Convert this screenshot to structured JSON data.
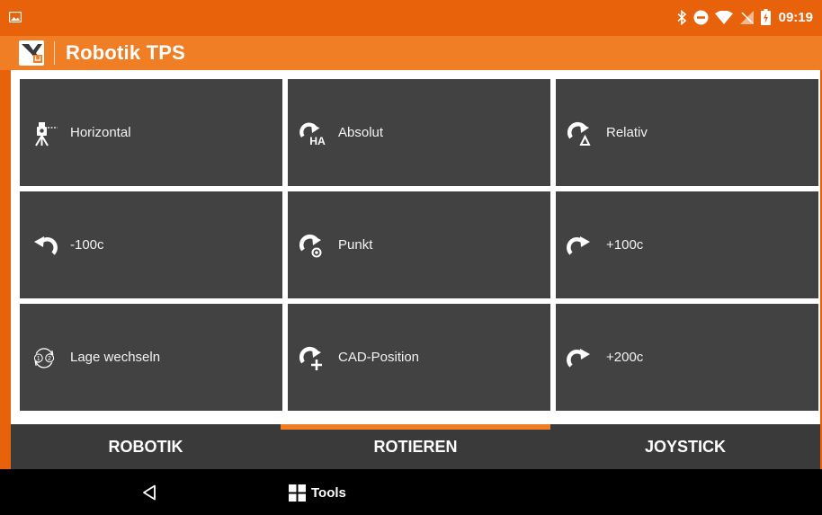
{
  "status": {
    "time": "09:19"
  },
  "app": {
    "title": "Robotik TPS",
    "accent": "#f07e25",
    "statusbar_color": "#e8620c"
  },
  "tiles": [
    {
      "label": "Horizontal",
      "icon": "total-station-icon"
    },
    {
      "label": "Absolut",
      "icon": "rotate-ha-icon"
    },
    {
      "label": "Relativ",
      "icon": "rotate-delta-icon"
    },
    {
      "label": "-100c",
      "icon": "rotate-left-icon"
    },
    {
      "label": "Punkt",
      "icon": "rotate-point-icon"
    },
    {
      "label": "+100c",
      "icon": "rotate-right-icon"
    },
    {
      "label": "Lage wechseln",
      "icon": "face-change-icon"
    },
    {
      "label": "CAD-Position",
      "icon": "rotate-cad-icon"
    },
    {
      "label": "+200c",
      "icon": "rotate-right-icon"
    }
  ],
  "tabs": [
    {
      "label": "ROBOTIK",
      "active": false
    },
    {
      "label": "ROTIEREN",
      "active": true
    },
    {
      "label": "JOYSTICK",
      "active": false
    }
  ],
  "navbar": {
    "tools_label": "Tools"
  }
}
